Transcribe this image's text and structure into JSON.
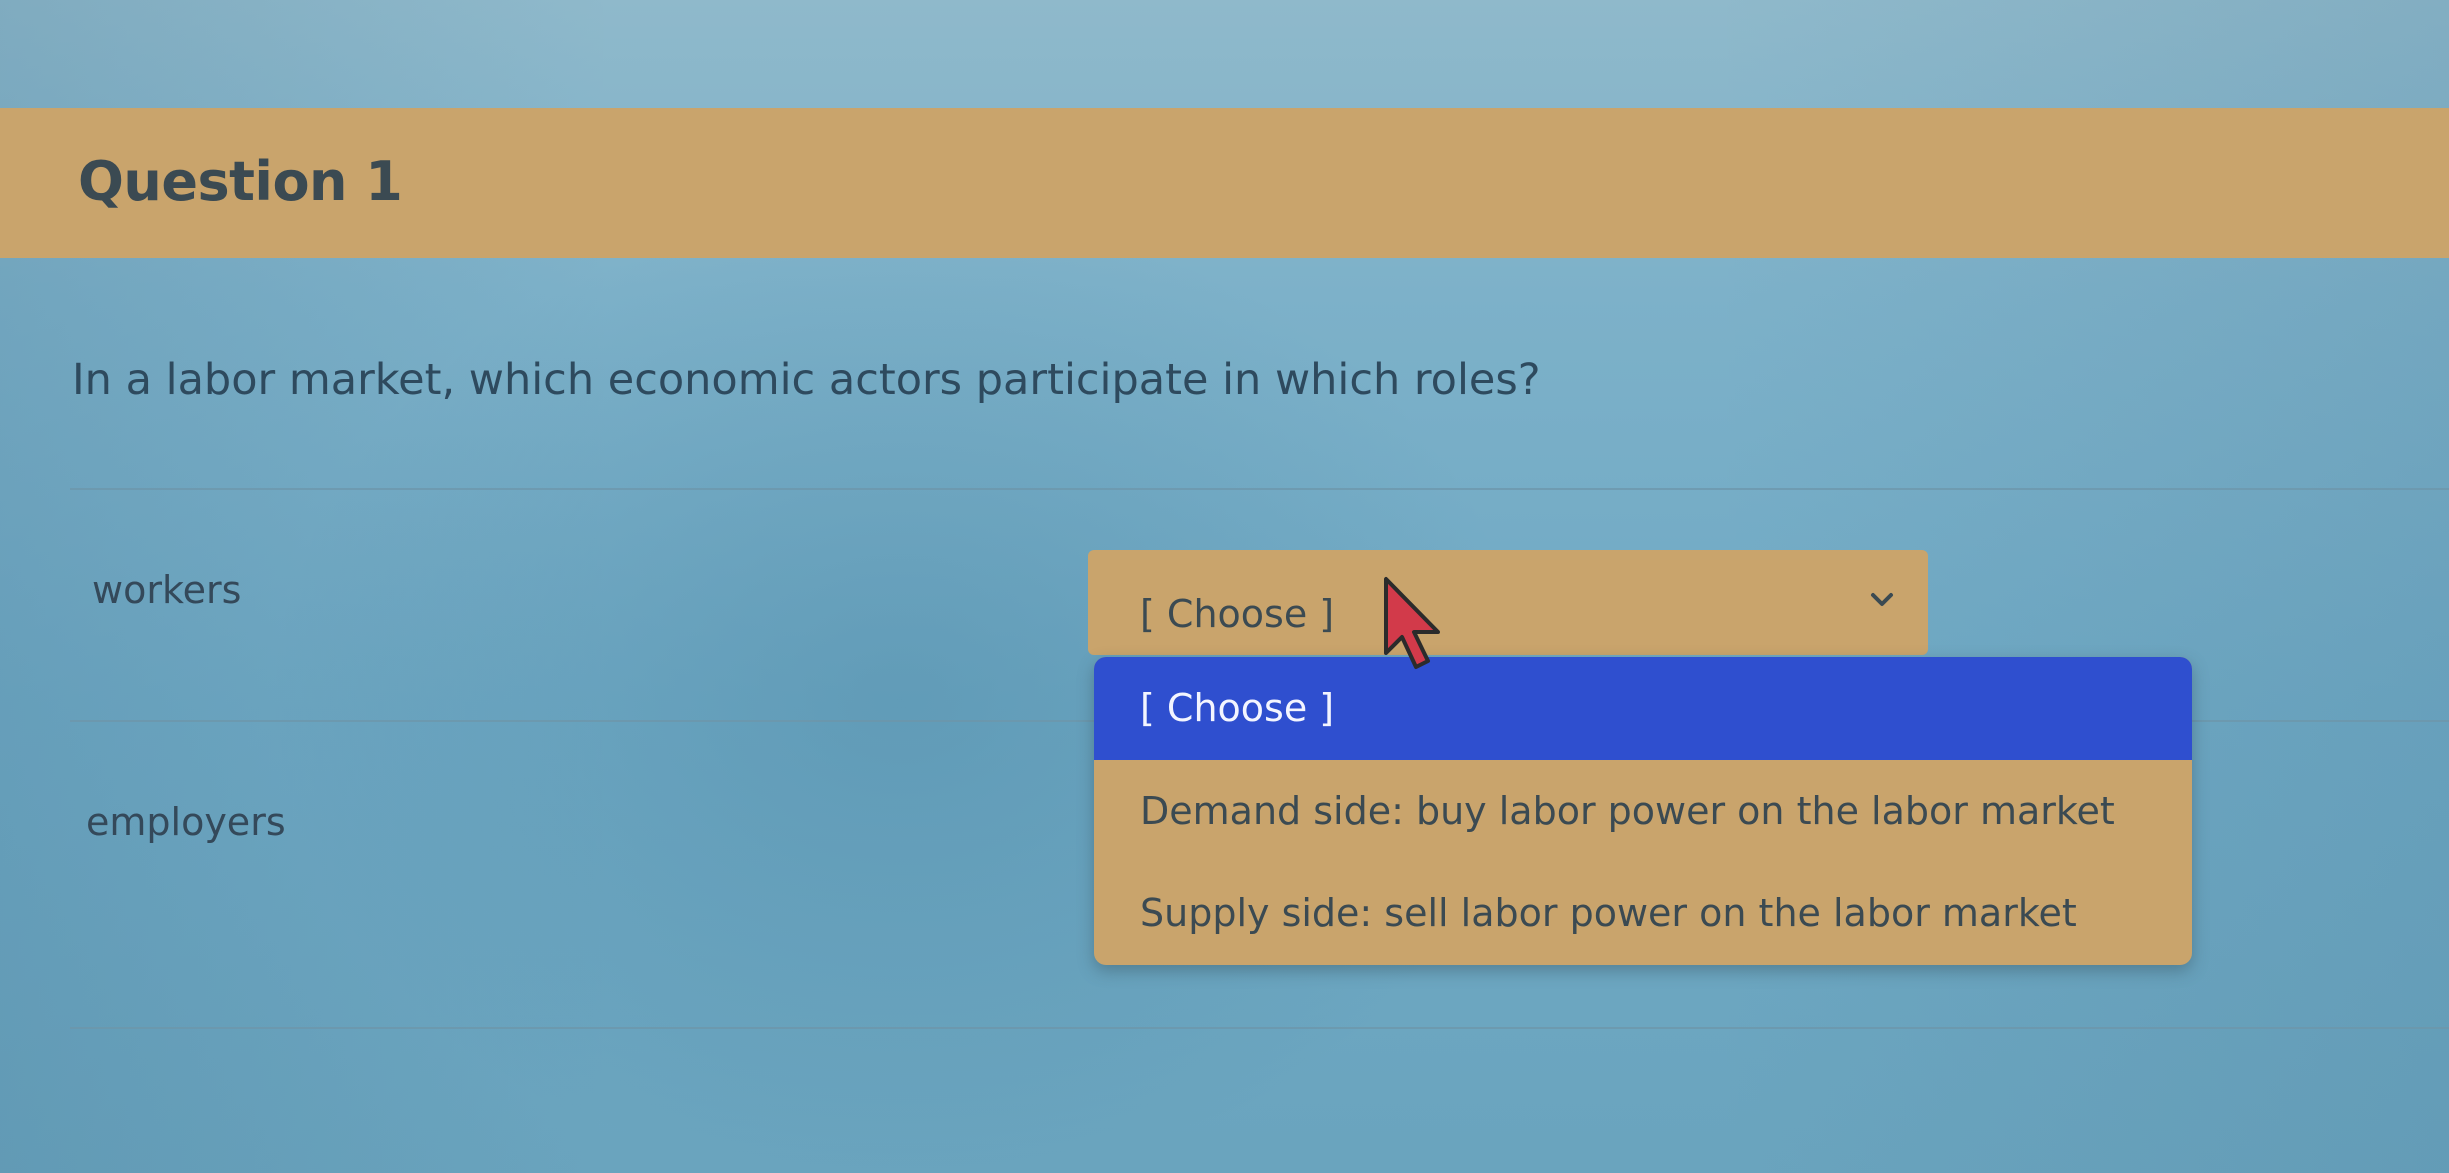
{
  "question": {
    "title": "Question 1",
    "prompt": "In a labor market, which economic actors participate in which roles?"
  },
  "rows": [
    {
      "label": "workers",
      "selected_value": "[ Choose ]"
    },
    {
      "label": "employers"
    }
  ],
  "dropdown": {
    "options": [
      "[ Choose ]",
      "Demand side: buy labor power on the labor market",
      "Supply side: sell labor power on the labor market"
    ],
    "highlighted_index": 0
  },
  "colors": {
    "background": "#7db1c9",
    "header_band": "#c9a46c",
    "select_fill": "#c9a46c",
    "highlight": "#2f4fcf",
    "cursor": "#d23a4a"
  },
  "icons": {
    "select_chevron": "chevron-down-icon",
    "pointer": "mouse-cursor-icon"
  }
}
